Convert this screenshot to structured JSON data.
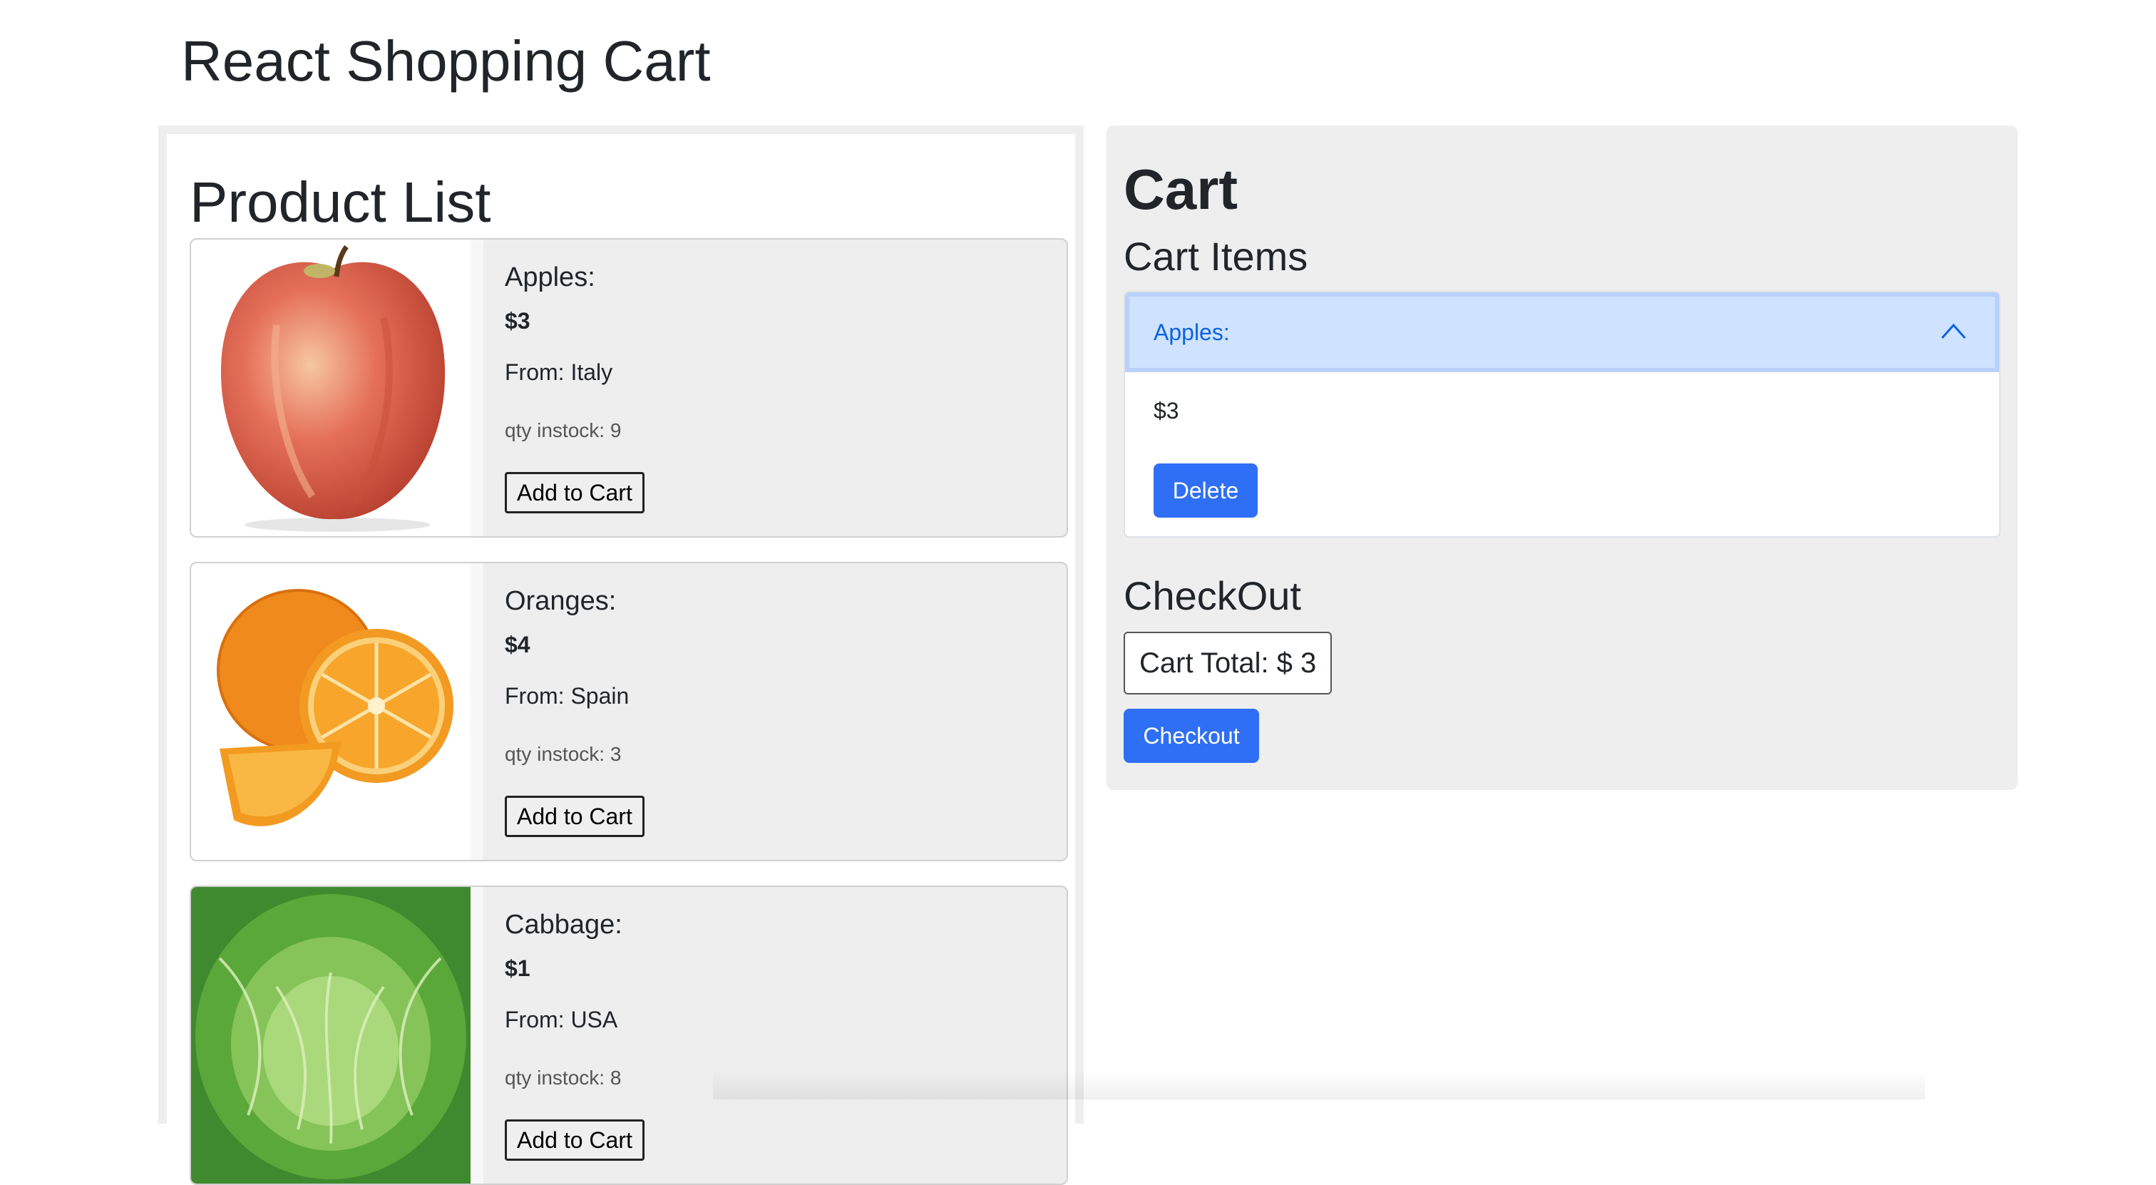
{
  "app": {
    "title": "React Shopping Cart"
  },
  "product_list": {
    "heading": "Product List",
    "add_label": "Add to Cart",
    "products": [
      {
        "name": "Apples:",
        "price": "$3",
        "origin": "From: Italy",
        "stock": "qty instock: 9",
        "image_icon": "apple-image"
      },
      {
        "name": "Oranges:",
        "price": "$4",
        "origin": "From: Spain",
        "stock": "qty instock: 3",
        "image_icon": "orange-image"
      },
      {
        "name": "Cabbage:",
        "price": "$1",
        "origin": "From: USA",
        "stock": "qty instock: 8",
        "image_icon": "cabbage-image"
      }
    ]
  },
  "cart": {
    "heading": "Cart",
    "items_heading": "Cart Items",
    "items": [
      {
        "name": "Apples:",
        "price": "$3",
        "expanded": true
      }
    ],
    "delete_label": "Delete",
    "chevron_icon": "chevron-up-icon",
    "checkout_heading": "CheckOut",
    "total_label": "Cart Total: $ 3",
    "checkout_label": "Checkout"
  },
  "colors": {
    "primary_button": "#2f6ff5",
    "accordion_active_bg": "#cfe2ff",
    "accordion_active_text": "#0c63e4",
    "panel_bg": "#eeeeee"
  }
}
